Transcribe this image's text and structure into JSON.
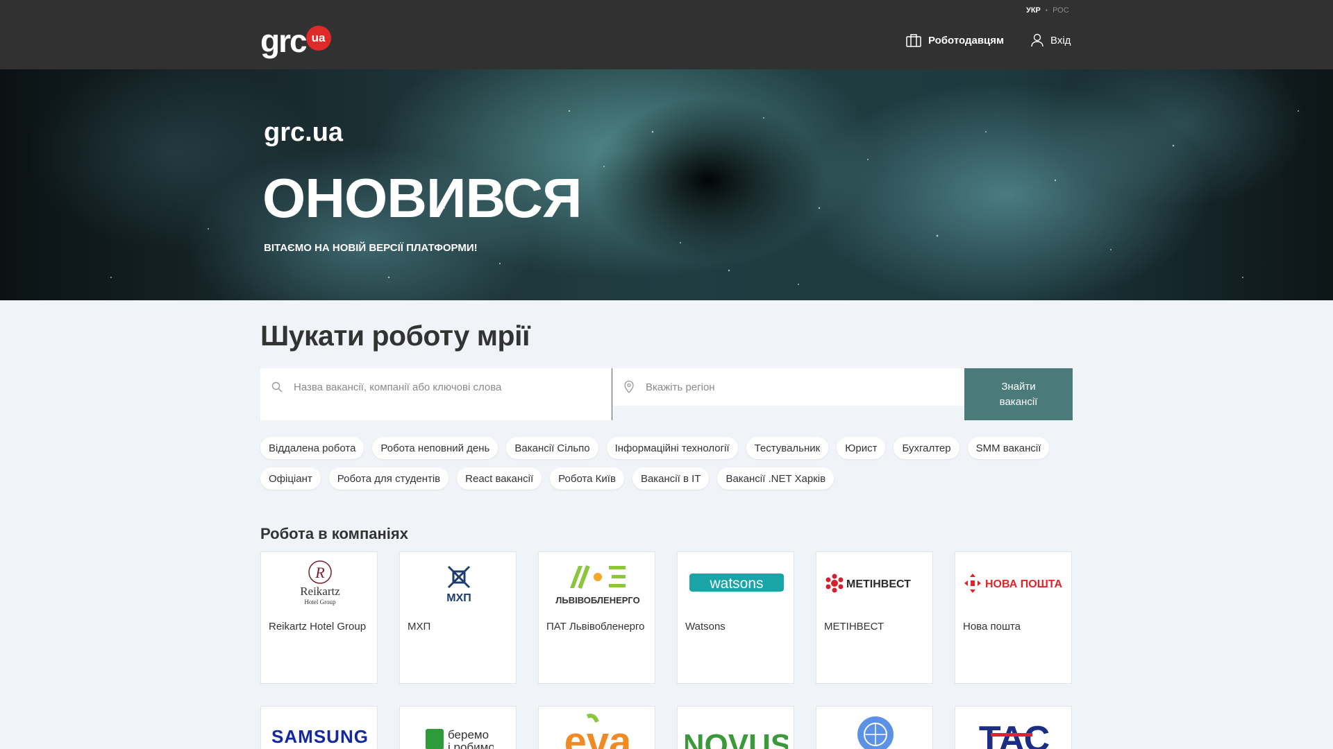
{
  "header": {
    "lang_active": "УКР",
    "lang_inactive": "РОС",
    "logo_text": "grc",
    "logo_badge": "ua",
    "employers_label": "Роботодавцям",
    "login_label": "Вхід"
  },
  "hero": {
    "brand": "grc.ua",
    "title": "ОНОВИВСЯ",
    "tagline": "ВІТАЄМО НА НОВІЙ ВЕРСІЇ ПЛАТФОРМИ!"
  },
  "search": {
    "title": "Шукати роботу мрії",
    "keywords_placeholder": "Назва вакансії, компанії або ключові слова",
    "region_placeholder": "Вкажіть регіон",
    "button_line1": "Знайти",
    "button_line2": "вакансії"
  },
  "chips_row1": [
    "Віддалена робота",
    "Робота неповний день",
    "Вакансії Сільпо",
    "Інформаційні технології",
    "Тестувальник",
    "Юрист",
    "Бухгалтер",
    "SMM вакансії"
  ],
  "chips_row2": [
    "Офіціант",
    "Робота для студентів",
    "React вакансії",
    "Робота Київ",
    "Вакансії в IT",
    "Вакансії .NET Харків"
  ],
  "companies": {
    "title": "Робота в компаніях",
    "row1": [
      {
        "name": "Reikartz Hotel Group",
        "logo": "reikartz-logo",
        "logo_text": "Reikartz",
        "logo_sub": "Hotel Group"
      },
      {
        "name": "МХП",
        "logo": "mhp-logo",
        "logo_text": "МХП"
      },
      {
        "name": "ПАТ Львівобленерго",
        "logo": "lvivoblenergo-logo",
        "logo_text": "ЛЬВІВОБЛЕНЕРГО"
      },
      {
        "name": "Watsons",
        "logo": "watsons-logo",
        "logo_text": "watsons"
      },
      {
        "name": "МЕТІНВЕСТ",
        "logo": "metinvest-logo",
        "logo_text": "МЕТІНВЕСТ"
      },
      {
        "name": "Нова пошта",
        "logo": "nova-poshta-logo",
        "logo_text": "НОВА ПОШТА"
      }
    ],
    "row2": [
      {
        "logo": "samsung-logo",
        "logo_text": "SAMSUNG"
      },
      {
        "logo": "beremo-logo",
        "logo_text": "беремо і робимо"
      },
      {
        "logo": "eva-logo",
        "logo_text": "eva"
      },
      {
        "logo": "novus-logo",
        "logo_text": "NOVUS"
      },
      {
        "logo": "un-logo",
        "logo_text": ""
      },
      {
        "logo": "tas-logo",
        "logo_text": "ТАС"
      }
    ]
  },
  "colors": {
    "header_bg": "#313131",
    "accent_red": "#e02a2a",
    "search_button": "#4a7a7a",
    "page_bg": "#f0f3f7"
  }
}
